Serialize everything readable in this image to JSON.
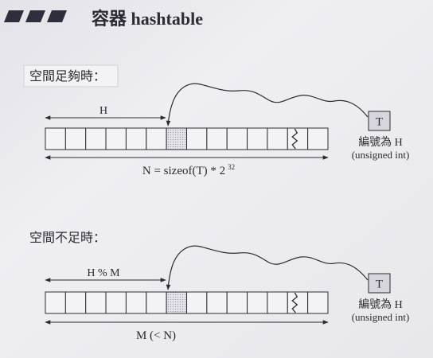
{
  "slide": {
    "title": "容器 hashtable"
  },
  "sections": [
    {
      "label": "空間足夠時：",
      "offset_label": "H",
      "size_label": "N = sizeof(T) * 2",
      "size_label_exponent": "32",
      "element_label": "T",
      "element_caption": "編號為 H",
      "element_type": "(unsigned int)"
    },
    {
      "label": "空間不足時：",
      "offset_label": "H % M",
      "size_label": "M (< N)",
      "element_label": "T",
      "element_caption": "編號為 H",
      "element_type": "(unsigned int)"
    }
  ],
  "icons": {
    "title_mark": "slanted-bars-icon"
  },
  "colors": {
    "ink": "#2b2b33",
    "background": "#ececef",
    "cell_fill": "#f3f3f5",
    "element_fill": "#d6d6dc",
    "bar_color": "#2e2e3e"
  }
}
